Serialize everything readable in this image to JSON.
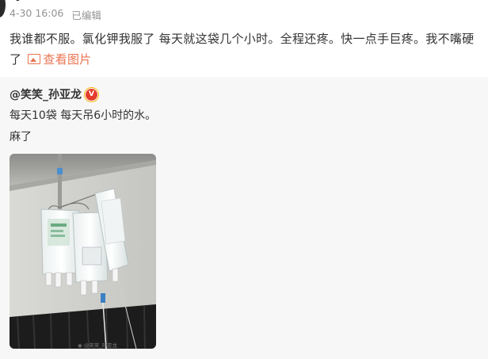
{
  "post": {
    "date": "4-30 16:06",
    "edited_label": "已编辑",
    "text": "我谁都不服。氯化钾我服了 每天就这袋几个小时。全程还疼。快一点手巨疼。我不嘴硬了",
    "view_pics_label": "查看图片"
  },
  "repost": {
    "username": "@笑笑_孙亚龙",
    "verified_glyph": "V",
    "line1": "每天10袋 每天吊6小时的水。",
    "line2": "麻了",
    "image": {
      "watermark": "@笑笑_孙亚龙",
      "icon": "weibo-icon"
    }
  },
  "colors": {
    "link": "#eb7350",
    "meta": "#939393",
    "repost_bg": "#f7f7f7",
    "verified_badge": "#e63c2c"
  }
}
